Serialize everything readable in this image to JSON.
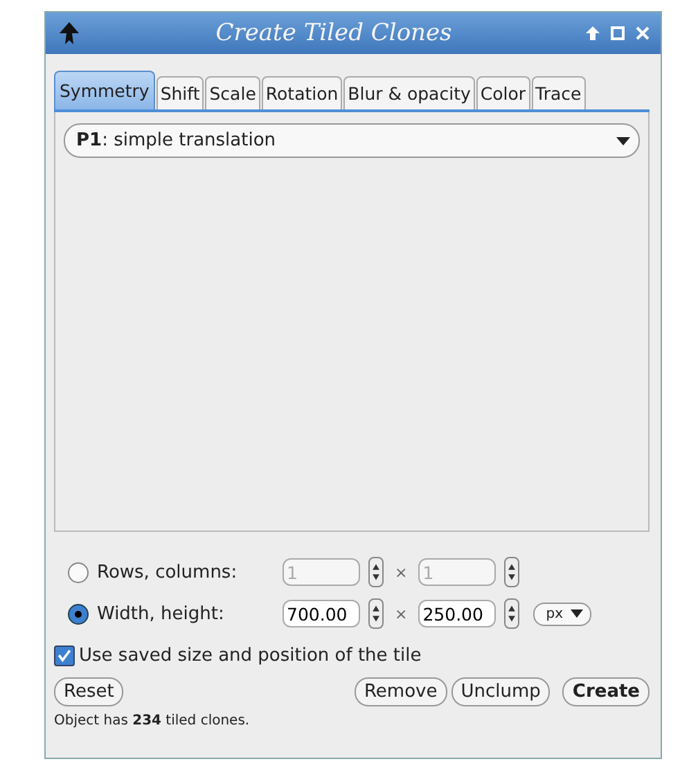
{
  "window": {
    "title": "Create Tiled Clones"
  },
  "tabs": [
    {
      "label": "Symmetry",
      "selected": true
    },
    {
      "label": "Shift",
      "selected": false
    },
    {
      "label": "Scale",
      "selected": false
    },
    {
      "label": "Rotation",
      "selected": false
    },
    {
      "label": "Blur & opacity",
      "selected": false
    },
    {
      "label": "Color",
      "selected": false
    },
    {
      "label": "Trace",
      "selected": false
    }
  ],
  "symmetry_select": {
    "value": "**P1**: simple translation"
  },
  "size_options": [
    {
      "label": "Rows, columns:",
      "selected": false,
      "disabled": true,
      "value_1": "1",
      "value_2": "1",
      "separator": "×"
    },
    {
      "label": "Width, height:",
      "selected": true,
      "disabled": false,
      "value_1": "700.00",
      "value_2": "250.00",
      "separator": "×",
      "unit": "px"
    }
  ],
  "use_saved": {
    "label": "Use saved size and position of the tile",
    "checked": true
  },
  "buttons": {
    "left": [
      "Reset"
    ],
    "right": [
      {
        "label": "Remove",
        "bold": false
      },
      {
        "label": "Unclump",
        "bold": false
      },
      {
        "label": "Create",
        "bold": true
      }
    ]
  },
  "status": "Object has **234** tiled clones."
}
